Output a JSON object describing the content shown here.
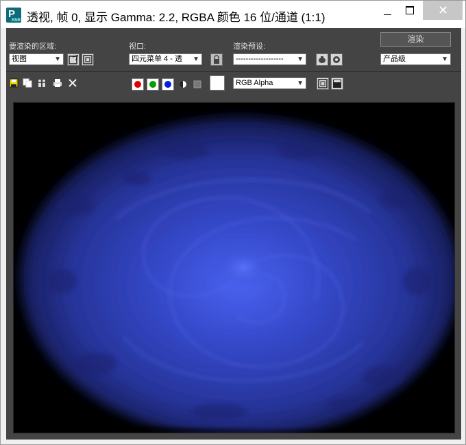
{
  "window": {
    "title": "透视, 帧 0, 显示 Gamma: 2.2, RGBA 颜色 16 位/通道 (1:1)",
    "icon_letter": "P",
    "icon_sub": "RNR"
  },
  "controls": {
    "area_label": "要渲染的区域:",
    "area_value": "视图",
    "viewport_label": "视口:",
    "viewport_value": "四元菜单 4 - 透",
    "preset_label": "渲染预设:",
    "preset_value": "-------------------",
    "render_button": "渲染",
    "quality_value": "产品级",
    "channel_value": "RGB Alpha"
  },
  "colors": {
    "panel": "#444444",
    "red_channel": "#e00000",
    "green_channel": "#00a000",
    "blue_channel": "#0020e0",
    "render_blue": "#3a4ed0"
  }
}
